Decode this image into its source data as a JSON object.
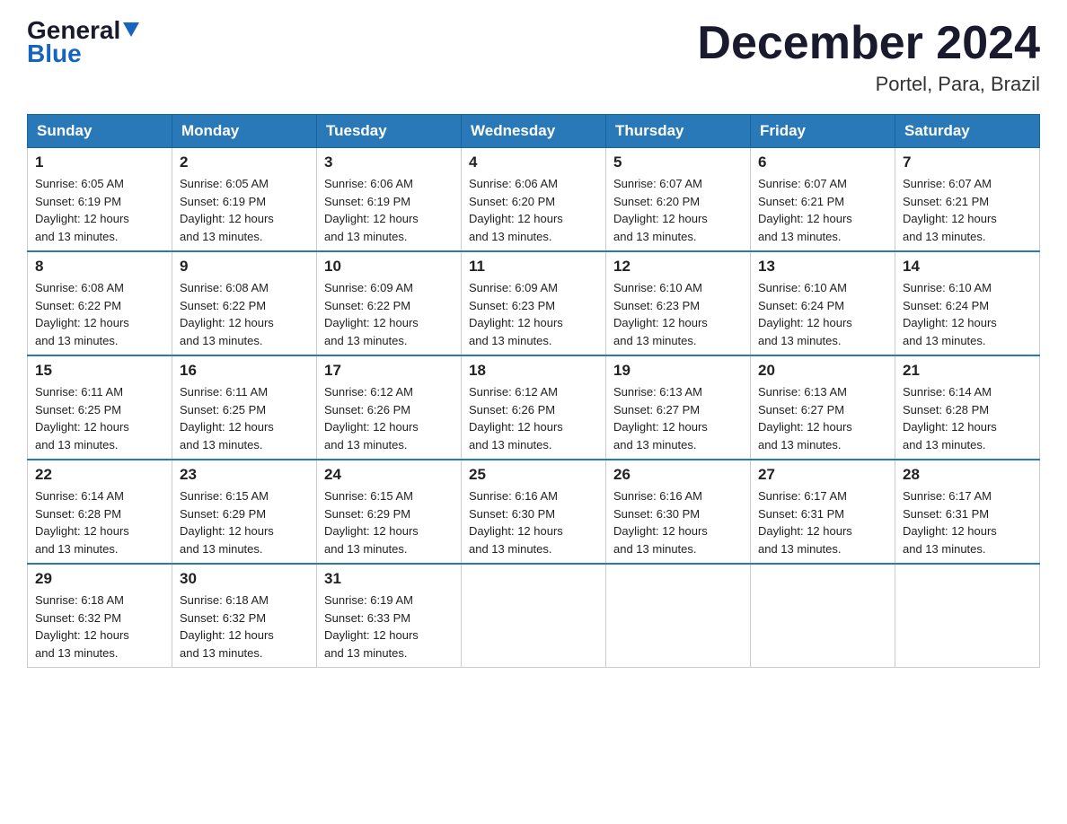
{
  "header": {
    "logo_general": "General",
    "logo_blue": "Blue",
    "month_title": "December 2024",
    "location": "Portel, Para, Brazil"
  },
  "weekdays": [
    "Sunday",
    "Monday",
    "Tuesday",
    "Wednesday",
    "Thursday",
    "Friday",
    "Saturday"
  ],
  "weeks": [
    [
      {
        "day": "1",
        "sunrise": "6:05 AM",
        "sunset": "6:19 PM",
        "daylight": "12 hours and 13 minutes."
      },
      {
        "day": "2",
        "sunrise": "6:05 AM",
        "sunset": "6:19 PM",
        "daylight": "12 hours and 13 minutes."
      },
      {
        "day": "3",
        "sunrise": "6:06 AM",
        "sunset": "6:19 PM",
        "daylight": "12 hours and 13 minutes."
      },
      {
        "day": "4",
        "sunrise": "6:06 AM",
        "sunset": "6:20 PM",
        "daylight": "12 hours and 13 minutes."
      },
      {
        "day": "5",
        "sunrise": "6:07 AM",
        "sunset": "6:20 PM",
        "daylight": "12 hours and 13 minutes."
      },
      {
        "day": "6",
        "sunrise": "6:07 AM",
        "sunset": "6:21 PM",
        "daylight": "12 hours and 13 minutes."
      },
      {
        "day": "7",
        "sunrise": "6:07 AM",
        "sunset": "6:21 PM",
        "daylight": "12 hours and 13 minutes."
      }
    ],
    [
      {
        "day": "8",
        "sunrise": "6:08 AM",
        "sunset": "6:22 PM",
        "daylight": "12 hours and 13 minutes."
      },
      {
        "day": "9",
        "sunrise": "6:08 AM",
        "sunset": "6:22 PM",
        "daylight": "12 hours and 13 minutes."
      },
      {
        "day": "10",
        "sunrise": "6:09 AM",
        "sunset": "6:22 PM",
        "daylight": "12 hours and 13 minutes."
      },
      {
        "day": "11",
        "sunrise": "6:09 AM",
        "sunset": "6:23 PM",
        "daylight": "12 hours and 13 minutes."
      },
      {
        "day": "12",
        "sunrise": "6:10 AM",
        "sunset": "6:23 PM",
        "daylight": "12 hours and 13 minutes."
      },
      {
        "day": "13",
        "sunrise": "6:10 AM",
        "sunset": "6:24 PM",
        "daylight": "12 hours and 13 minutes."
      },
      {
        "day": "14",
        "sunrise": "6:10 AM",
        "sunset": "6:24 PM",
        "daylight": "12 hours and 13 minutes."
      }
    ],
    [
      {
        "day": "15",
        "sunrise": "6:11 AM",
        "sunset": "6:25 PM",
        "daylight": "12 hours and 13 minutes."
      },
      {
        "day": "16",
        "sunrise": "6:11 AM",
        "sunset": "6:25 PM",
        "daylight": "12 hours and 13 minutes."
      },
      {
        "day": "17",
        "sunrise": "6:12 AM",
        "sunset": "6:26 PM",
        "daylight": "12 hours and 13 minutes."
      },
      {
        "day": "18",
        "sunrise": "6:12 AM",
        "sunset": "6:26 PM",
        "daylight": "12 hours and 13 minutes."
      },
      {
        "day": "19",
        "sunrise": "6:13 AM",
        "sunset": "6:27 PM",
        "daylight": "12 hours and 13 minutes."
      },
      {
        "day": "20",
        "sunrise": "6:13 AM",
        "sunset": "6:27 PM",
        "daylight": "12 hours and 13 minutes."
      },
      {
        "day": "21",
        "sunrise": "6:14 AM",
        "sunset": "6:28 PM",
        "daylight": "12 hours and 13 minutes."
      }
    ],
    [
      {
        "day": "22",
        "sunrise": "6:14 AM",
        "sunset": "6:28 PM",
        "daylight": "12 hours and 13 minutes."
      },
      {
        "day": "23",
        "sunrise": "6:15 AM",
        "sunset": "6:29 PM",
        "daylight": "12 hours and 13 minutes."
      },
      {
        "day": "24",
        "sunrise": "6:15 AM",
        "sunset": "6:29 PM",
        "daylight": "12 hours and 13 minutes."
      },
      {
        "day": "25",
        "sunrise": "6:16 AM",
        "sunset": "6:30 PM",
        "daylight": "12 hours and 13 minutes."
      },
      {
        "day": "26",
        "sunrise": "6:16 AM",
        "sunset": "6:30 PM",
        "daylight": "12 hours and 13 minutes."
      },
      {
        "day": "27",
        "sunrise": "6:17 AM",
        "sunset": "6:31 PM",
        "daylight": "12 hours and 13 minutes."
      },
      {
        "day": "28",
        "sunrise": "6:17 AM",
        "sunset": "6:31 PM",
        "daylight": "12 hours and 13 minutes."
      }
    ],
    [
      {
        "day": "29",
        "sunrise": "6:18 AM",
        "sunset": "6:32 PM",
        "daylight": "12 hours and 13 minutes."
      },
      {
        "day": "30",
        "sunrise": "6:18 AM",
        "sunset": "6:32 PM",
        "daylight": "12 hours and 13 minutes."
      },
      {
        "day": "31",
        "sunrise": "6:19 AM",
        "sunset": "6:33 PM",
        "daylight": "12 hours and 13 minutes."
      },
      null,
      null,
      null,
      null
    ]
  ]
}
